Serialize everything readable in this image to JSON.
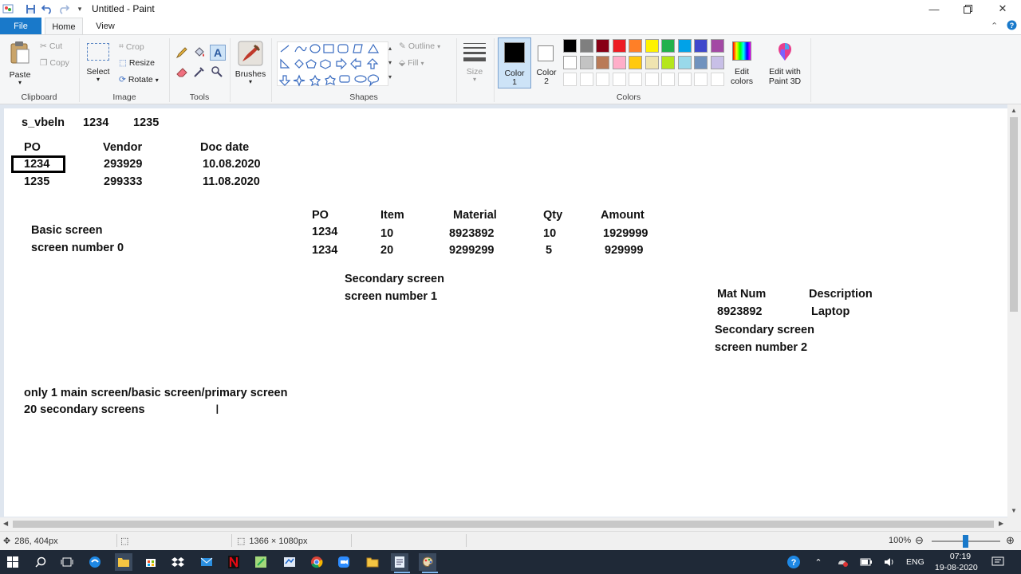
{
  "titlebar": {
    "title": "Untitled - Paint"
  },
  "tabs": {
    "file": "File",
    "home": "Home",
    "view": "View"
  },
  "clipboard": {
    "paste": "Paste",
    "cut": "Cut",
    "copy": "Copy",
    "label": "Clipboard"
  },
  "image": {
    "select": "Select",
    "crop": "Crop",
    "resize": "Resize",
    "rotate": "Rotate",
    "label": "Image"
  },
  "tools": {
    "label": "Tools"
  },
  "brushes": {
    "label": "Brushes"
  },
  "shapes": {
    "outline": "Outline",
    "fill": "Fill",
    "label": "Shapes"
  },
  "size": {
    "label": "Size"
  },
  "colors": {
    "color1": "Color",
    "color1_num": "1",
    "color2": "Color",
    "color2_num": "2",
    "edit_colors": "Edit colors",
    "edit_paint3d": "Edit with Paint 3D",
    "label": "Colors",
    "palette_row1": [
      "#000000",
      "#7f7f7f",
      "#880015",
      "#ed1c24",
      "#ff7f27",
      "#fff200",
      "#22b14c",
      "#00a2e8",
      "#3f48cc",
      "#a349a4"
    ],
    "palette_row2": [
      "#ffffff",
      "#c3c3c3",
      "#b97a57",
      "#ffaec9",
      "#ffc90e",
      "#efe4b0",
      "#b5e61d",
      "#99d9ea",
      "#7092be",
      "#c8bfe7"
    ]
  },
  "canvas": {
    "s_vbeln": "s_vbeln",
    "s_v1": "1234",
    "s_v2": "1235",
    "h_po": "PO",
    "h_vendor": "Vendor",
    "h_docdate": "Doc date",
    "r1_po": "1234",
    "r1_vendor": "293929",
    "r1_date": "10.08.2020",
    "r2_po": "1235",
    "r2_vendor": "299333",
    "r2_date": "11.08.2020",
    "basic1": "Basic screen",
    "basic2": "screen number 0",
    "t2_po": "PO",
    "t2_item": "Item",
    "t2_material": "Material",
    "t2_qty": "Qty",
    "t2_amount": "Amount",
    "t2r1_po": "1234",
    "t2r1_item": "10",
    "t2r1_mat": "8923892",
    "t2r1_qty": "10",
    "t2r1_amt": "1929999",
    "t2r2_po": "1234",
    "t2r2_item": "20",
    "t2r2_mat": "9299299",
    "t2r2_qty": "5",
    "t2r2_amt": "929999",
    "sec1a": "Secondary screen",
    "sec1b": "screen number 1",
    "t3_matnum": "Mat Num",
    "t3_desc": "Description",
    "t3_val": "8923892",
    "t3_laptop": "Laptop",
    "sec2a": "Secondary screen",
    "sec2b": "screen number 2",
    "note1": "only 1 main screen/basic screen/primary screen",
    "note2": "20 secondary screens"
  },
  "status": {
    "cursor_pos": "286, 404px",
    "image_size": "1366 × 1080px",
    "zoom": "100%"
  },
  "taskbar": {
    "lang": "ENG",
    "time": "07:19",
    "date": "19-08-2020"
  }
}
